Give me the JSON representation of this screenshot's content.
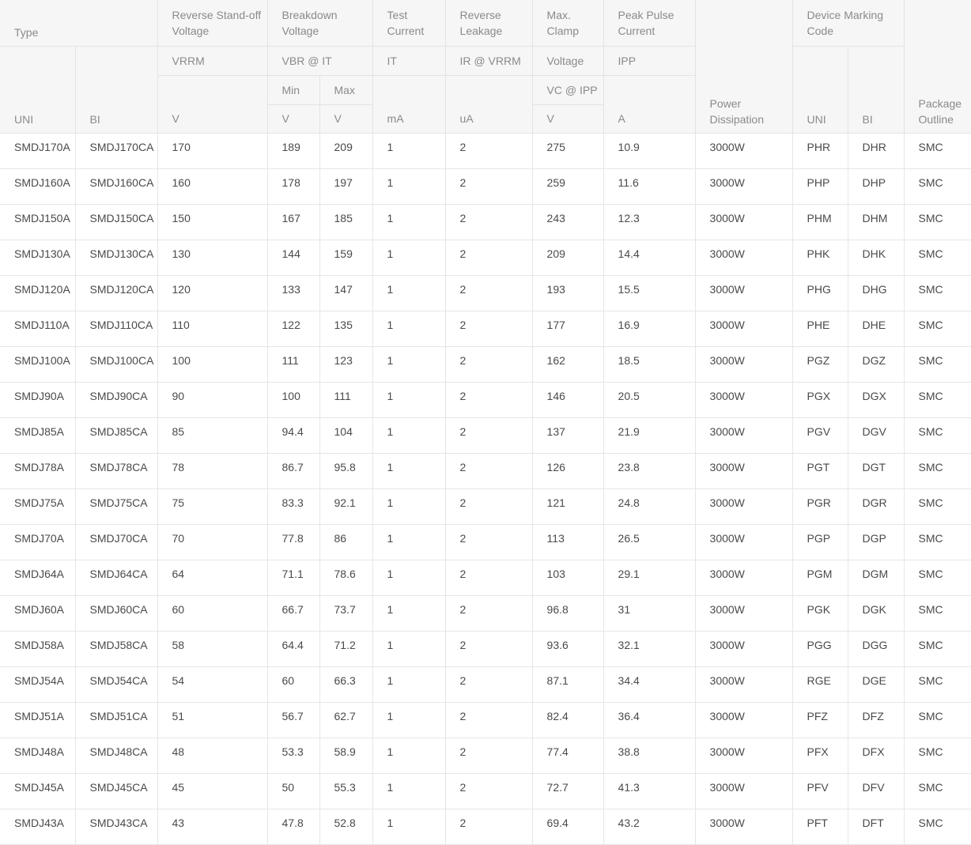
{
  "header": {
    "type": "Type",
    "reverse_standoff": "Reverse Stand-off Voltage",
    "breakdown": "Breakdown Voltage",
    "test_current": "Test Current",
    "reverse_leakage": "Reverse Leakage",
    "max_clamp": "Max. Clamp",
    "peak_pulse": "Peak Pulse Current",
    "power": "Power Dissipation",
    "marking": "Device Marking Code",
    "package": "Package Outline",
    "vrrm": "VRRM",
    "vbr_it": "VBR @ IT",
    "it": "IT",
    "ir_vrrm": "IR @ VRRM",
    "voltage": "Voltage",
    "ipp": "IPP",
    "min": "Min",
    "max": "Max",
    "vc_ipp": "VC @ IPP",
    "uni": "UNI",
    "bi": "BI",
    "unit_v_standoff": "V",
    "unit_v_min": "V",
    "unit_v_max": "V",
    "unit_ma": "mA",
    "unit_ua": "uA",
    "unit_v_clamp": "V",
    "unit_a": "A",
    "marking_uni": "UNI",
    "marking_bi": "BI"
  },
  "rows": [
    [
      "SMDJ170A",
      "SMDJ170CA",
      "170",
      "189",
      "209",
      "1",
      "2",
      "275",
      "10.9",
      "3000W",
      "PHR",
      "DHR",
      "SMC"
    ],
    [
      "SMDJ160A",
      "SMDJ160CA",
      "160",
      "178",
      "197",
      "1",
      "2",
      "259",
      "11.6",
      "3000W",
      "PHP",
      "DHP",
      "SMC"
    ],
    [
      "SMDJ150A",
      "SMDJ150CA",
      "150",
      "167",
      "185",
      "1",
      "2",
      "243",
      "12.3",
      "3000W",
      "PHM",
      "DHM",
      "SMC"
    ],
    [
      "SMDJ130A",
      "SMDJ130CA",
      "130",
      "144",
      "159",
      "1",
      "2",
      "209",
      "14.4",
      "3000W",
      "PHK",
      "DHK",
      "SMC"
    ],
    [
      "SMDJ120A",
      "SMDJ120CA",
      "120",
      "133",
      "147",
      "1",
      "2",
      "193",
      "15.5",
      "3000W",
      "PHG",
      "DHG",
      "SMC"
    ],
    [
      "SMDJ110A",
      "SMDJ110CA",
      "110",
      "122",
      "135",
      "1",
      "2",
      "177",
      "16.9",
      "3000W",
      "PHE",
      "DHE",
      "SMC"
    ],
    [
      "SMDJ100A",
      "SMDJ100CA",
      "100",
      "111",
      "123",
      "1",
      "2",
      "162",
      "18.5",
      "3000W",
      "PGZ",
      "DGZ",
      "SMC"
    ],
    [
      "SMDJ90A",
      "SMDJ90CA",
      "90",
      "100",
      "111",
      "1",
      "2",
      "146",
      "20.5",
      "3000W",
      "PGX",
      "DGX",
      "SMC"
    ],
    [
      "SMDJ85A",
      "SMDJ85CA",
      "85",
      "94.4",
      "104",
      "1",
      "2",
      "137",
      "21.9",
      "3000W",
      "PGV",
      "DGV",
      "SMC"
    ],
    [
      "SMDJ78A",
      "SMDJ78CA",
      "78",
      "86.7",
      "95.8",
      "1",
      "2",
      "126",
      "23.8",
      "3000W",
      "PGT",
      "DGT",
      "SMC"
    ],
    [
      "SMDJ75A",
      "SMDJ75CA",
      "75",
      "83.3",
      "92.1",
      "1",
      "2",
      "121",
      "24.8",
      "3000W",
      "PGR",
      "DGR",
      "SMC"
    ],
    [
      "SMDJ70A",
      "SMDJ70CA",
      "70",
      "77.8",
      "86",
      "1",
      "2",
      "113",
      "26.5",
      "3000W",
      "PGP",
      "DGP",
      "SMC"
    ],
    [
      "SMDJ64A",
      "SMDJ64CA",
      "64",
      "71.1",
      "78.6",
      "1",
      "2",
      "103",
      "29.1",
      "3000W",
      "PGM",
      "DGM",
      "SMC"
    ],
    [
      "SMDJ60A",
      "SMDJ60CA",
      "60",
      "66.7",
      "73.7",
      "1",
      "2",
      "96.8",
      "31",
      "3000W",
      "PGK",
      "DGK",
      "SMC"
    ],
    [
      "SMDJ58A",
      "SMDJ58CA",
      "58",
      "64.4",
      "71.2",
      "1",
      "2",
      "93.6",
      "32.1",
      "3000W",
      "PGG",
      "DGG",
      "SMC"
    ],
    [
      "SMDJ54A",
      "SMDJ54CA",
      "54",
      "60",
      "66.3",
      "1",
      "2",
      "87.1",
      "34.4",
      "3000W",
      "RGE",
      "DGE",
      "SMC"
    ],
    [
      "SMDJ51A",
      "SMDJ51CA",
      "51",
      "56.7",
      "62.7",
      "1",
      "2",
      "82.4",
      "36.4",
      "3000W",
      "PFZ",
      "DFZ",
      "SMC"
    ],
    [
      "SMDJ48A",
      "SMDJ48CA",
      "48",
      "53.3",
      "58.9",
      "1",
      "2",
      "77.4",
      "38.8",
      "3000W",
      "PFX",
      "DFX",
      "SMC"
    ],
    [
      "SMDJ45A",
      "SMDJ45CA",
      "45",
      "50",
      "55.3",
      "1",
      "2",
      "72.7",
      "41.3",
      "3000W",
      "PFV",
      "DFV",
      "SMC"
    ],
    [
      "SMDJ43A",
      "SMDJ43CA",
      "43",
      "47.8",
      "52.8",
      "1",
      "2",
      "69.4",
      "43.2",
      "3000W",
      "PFT",
      "DFT",
      "SMC"
    ]
  ]
}
